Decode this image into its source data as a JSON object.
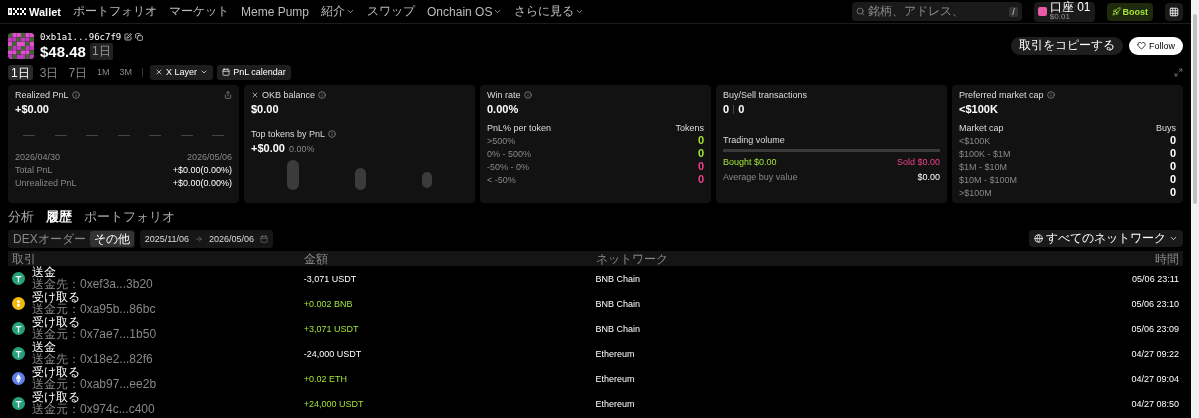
{
  "nav": {
    "logo": "Wallet",
    "items": [
      {
        "label": "ポートフォリオ",
        "dropdown": false
      },
      {
        "label": "マーケット",
        "dropdown": false
      },
      {
        "label": "Meme Pump",
        "dropdown": false
      },
      {
        "label": "紹介",
        "dropdown": true
      },
      {
        "label": "スワップ",
        "dropdown": false
      },
      {
        "label": "Onchain OS",
        "dropdown": true
      },
      {
        "label": "さらに見る",
        "dropdown": true
      }
    ],
    "search": {
      "placeholder": "銘柄、アドレス、",
      "shortcut": "/"
    },
    "account": {
      "name": "口座 01",
      "sub": "$0.01"
    },
    "boost": "Boost"
  },
  "profile": {
    "address": "0xb1a1...96c7f9",
    "balance": "$48.48",
    "badge": "1日",
    "copy_button": "取引をコピーする",
    "follow_button": "Follow"
  },
  "timeframes": [
    {
      "label": "1日",
      "selected": true
    },
    {
      "label": "3日",
      "selected": false
    },
    {
      "label": "7日",
      "selected": false
    },
    {
      "label": "1M",
      "selected": false
    },
    {
      "label": "3M",
      "selected": false
    }
  ],
  "chain_filter": "X Layer",
  "calendar_button": "PnL calendar",
  "cards": [
    {
      "kind": "pnl",
      "title": "Realized PnL",
      "value": "+$0.00",
      "start_date": "2026/04/30",
      "end_date": "2026/05/06",
      "rows": [
        {
          "label": "Total PnL",
          "value": "+$0.00(0.00%)"
        },
        {
          "label": "Unrealized PnL",
          "value": "+$0.00(0.00%)"
        }
      ]
    },
    {
      "kind": "balance",
      "title": "OKB balance",
      "value": "$0.00",
      "subtitle": "Top tokens by PnL",
      "sub_value": "+$0.00",
      "sub_percent": "0.00%"
    },
    {
      "kind": "table",
      "title": "Win rate",
      "value": "0.00%",
      "head": [
        "PnL% per token",
        "Tokens"
      ],
      "rows": [
        {
          "label": ">500%",
          "value": "0",
          "color": "#a3e635"
        },
        {
          "label": "0% - 500%",
          "value": "0",
          "color": "#a3e635"
        },
        {
          "label": "-50% - 0%",
          "value": "0",
          "color": "#f0408f"
        },
        {
          "label": "< -50%",
          "value": "0",
          "color": "#f0408f"
        }
      ]
    },
    {
      "kind": "trades",
      "title": "Buy/Sell transactions",
      "buys": "0",
      "sells": "0",
      "volume_label": "Trading volume",
      "bought": "Bought $0.00",
      "sold": "Sold $0.00",
      "avg_label": "Average buy value",
      "avg_value": "$0.00"
    },
    {
      "kind": "table",
      "title": "Preferred market cap",
      "value": "<$100K",
      "head": [
        "Market cap",
        "Buys"
      ],
      "rows": [
        {
          "label": "<$100K",
          "value": "0"
        },
        {
          "label": "$100K - $1M",
          "value": "0"
        },
        {
          "label": "$1M - $10M",
          "value": "0"
        },
        {
          "label": "$10M - $100M",
          "value": "0"
        },
        {
          "label": ">$100M",
          "value": "0"
        }
      ]
    }
  ],
  "section_tabs": [
    {
      "label": "分析",
      "selected": false
    },
    {
      "label": "履歴",
      "selected": true
    },
    {
      "label": "ポートフォリオ",
      "selected": false
    }
  ],
  "order_filters": [
    {
      "label": "DEXオーダー",
      "selected": false
    },
    {
      "label": "その他",
      "selected": true
    }
  ],
  "date_range": {
    "start": "2025/11/06",
    "end": "2026/05/06"
  },
  "network_filter": "すべてのネットワーク",
  "table": {
    "columns": [
      "取引",
      "金額",
      "ネットワーク",
      "時間"
    ],
    "rows": [
      {
        "kind": "usdt",
        "type": "送金",
        "counterparty": "送金先：0xef3a...3b20",
        "amount": "-3,071 USDT",
        "incoming": false,
        "network": "BNB Chain",
        "time": "05/06 23:11"
      },
      {
        "kind": "bnb",
        "type": "受け取る",
        "counterparty": "送金元：0xa95b...86bc",
        "amount": "+0.002 BNB",
        "incoming": true,
        "network": "BNB Chain",
        "time": "05/06 23:10"
      },
      {
        "kind": "usdt",
        "type": "受け取る",
        "counterparty": "送金元：0x7ae7...1b50",
        "amount": "+3,071 USDT",
        "incoming": true,
        "network": "BNB Chain",
        "time": "05/06 23:09"
      },
      {
        "kind": "usdt",
        "type": "送金",
        "counterparty": "送金先：0x18e2...82f6",
        "amount": "-24,000 USDT",
        "incoming": false,
        "network": "Ethereum",
        "time": "04/27 09:22"
      },
      {
        "kind": "eth",
        "type": "受け取る",
        "counterparty": "送金元：0xab97...ee2b",
        "amount": "+0.02 ETH",
        "incoming": true,
        "network": "Ethereum",
        "time": "04/27 09:04"
      },
      {
        "kind": "usdt",
        "type": "受け取る",
        "counterparty": "送金元：0x974c...c400",
        "amount": "+24,000 USDT",
        "incoming": true,
        "network": "Ethereum",
        "time": "04/27 08:50"
      }
    ]
  }
}
